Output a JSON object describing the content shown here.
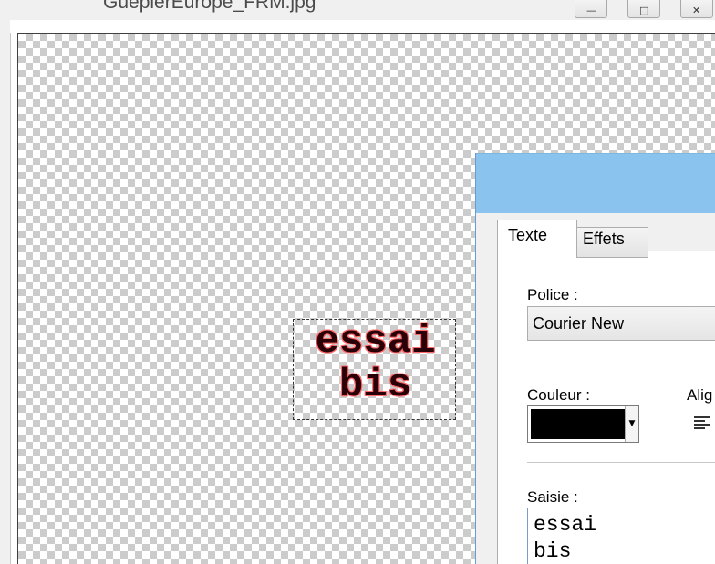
{
  "window": {
    "title": "GuepierEurope_FRM.jpg"
  },
  "canvas": {
    "text_line1": "essai",
    "text_line2": "bis",
    "text_fill_color": "#2a0008",
    "text_outline_color": "#ff6a6a"
  },
  "dialog": {
    "tabs": [
      {
        "label": "Texte",
        "selected": true
      },
      {
        "label": "Effets",
        "selected": false
      }
    ],
    "police_label": "Police :",
    "police_value": "Courier New",
    "couleur_label": "Couleur :",
    "couleur_value": "#000000",
    "alignement_label": "Alig",
    "saisie_label": "Saisie :",
    "saisie_value": "essai\nbis"
  },
  "colors": {
    "dialog_titlebar": "#8ac4ee",
    "dialog_bg": "#f0f0f0",
    "checker_dark": "#cccccc"
  }
}
